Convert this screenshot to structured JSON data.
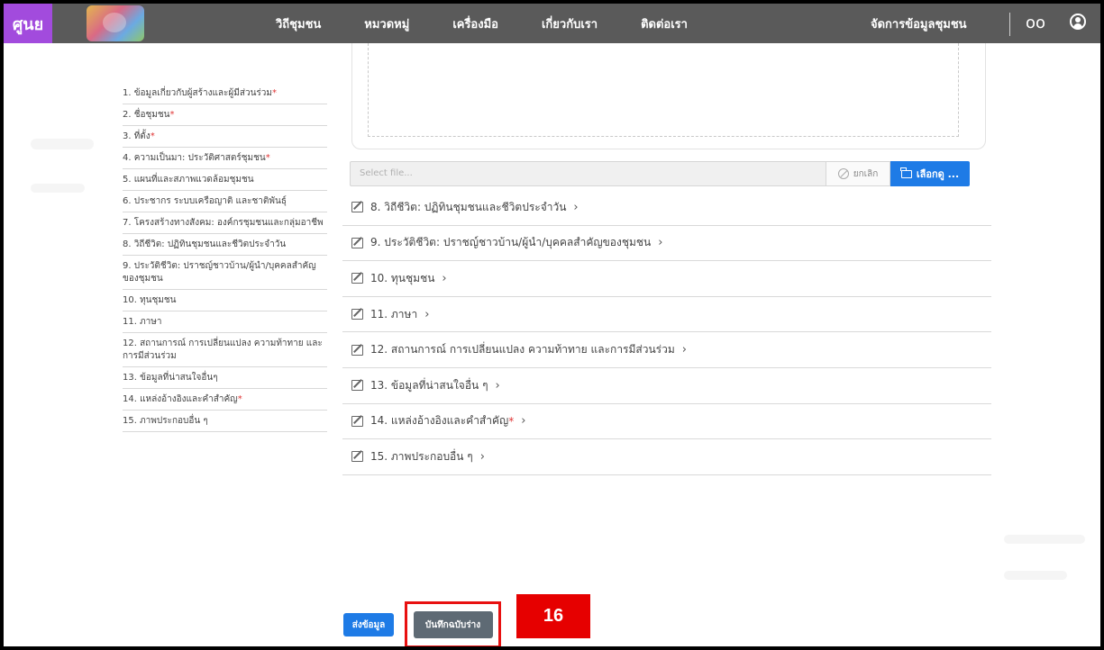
{
  "brand": {
    "logo_text": "ศูนย"
  },
  "nav": {
    "items": [
      "วิถีชุมชน",
      "หมวดหมู่",
      "เครื่องมือ",
      "เกี่ยวกับเรา",
      "ติดต่อเรา"
    ],
    "manage": "จัดการข้อมูลชุมชน",
    "glasses_icon": "oo"
  },
  "sidebar": {
    "items": [
      {
        "label": "1. ข้อมูลเกี่ยวกับผู้สร้างและผู้มีส่วนร่วม",
        "required": "*"
      },
      {
        "label": "2. ชื่อชุมชน",
        "required": "*"
      },
      {
        "label": "3. ที่ตั้ง",
        "required": "*"
      },
      {
        "label": "4. ความเป็นมา: ประวัติศาสตร์ชุมชน",
        "required": "*"
      },
      {
        "label": "5. แผนที่และสภาพแวดล้อมชุมชน",
        "required": ""
      },
      {
        "label": "6. ประชากร ระบบเครือญาติ และชาติพันธุ์",
        "required": ""
      },
      {
        "label": "7. โครงสร้างทางสังคม: องค์กรชุมชนและกลุ่มอาชีพ",
        "required": ""
      },
      {
        "label": "8. วิถีชีวิต: ปฏิทินชุมชนและชีวิตประจำวัน",
        "required": ""
      },
      {
        "label": "9. ประวัติชีวิต: ปราชญ์ชาวบ้าน/ผู้นำ/บุคคลสำคัญของชุมชน",
        "required": ""
      },
      {
        "label": "10. ทุนชุมชน",
        "required": ""
      },
      {
        "label": "11. ภาษา",
        "required": ""
      },
      {
        "label": "12. สถานการณ์ การเปลี่ยนแปลง ความท้าทาย และการมีส่วนร่วม",
        "required": ""
      },
      {
        "label": "13. ข้อมูลที่น่าสนใจอื่นๆ",
        "required": ""
      },
      {
        "label": "14. แหล่งอ้างอิงและคำสำคัญ",
        "required": "*"
      },
      {
        "label": "15. ภาพประกอบอื่น ๆ",
        "required": ""
      }
    ]
  },
  "file_input": {
    "placeholder": "Select file...",
    "cancel_label": "ยกเลิก",
    "browse_label": "เลือกดู ..."
  },
  "sections": [
    {
      "label": "8. วิถีชีวิต: ปฏิทินชุมชนและชีวิตประจำวัน",
      "required": ""
    },
    {
      "label": "9. ประวัติชีวิต: ปราชญ์ชาวบ้าน/ผู้นำ/บุคคลสำคัญของชุมชน",
      "required": ""
    },
    {
      "label": "10. ทุนชุมชน",
      "required": ""
    },
    {
      "label": "11. ภาษา",
      "required": ""
    },
    {
      "label": "12. สถานการณ์ การเปลี่ยนแปลง ความท้าทาย และการมีส่วนร่วม",
      "required": ""
    },
    {
      "label": "13. ข้อมูลที่น่าสนใจอื่น ๆ",
      "required": ""
    },
    {
      "label": "14. แหล่งอ้างอิงและคำสำคัญ",
      "required": "*"
    },
    {
      "label": "15. ภาพประกอบอื่น ๆ",
      "required": ""
    }
  ],
  "chevron": "›",
  "actions": {
    "send_label": "ส่งข้อมูล",
    "draft_label": "บันทึกฉบับร่าง"
  },
  "step_badge": "16",
  "colors": {
    "navbar": "#5a5a5a",
    "brand": "#a24bdd",
    "primary": "#1e7be6",
    "highlight": "#e81010"
  }
}
